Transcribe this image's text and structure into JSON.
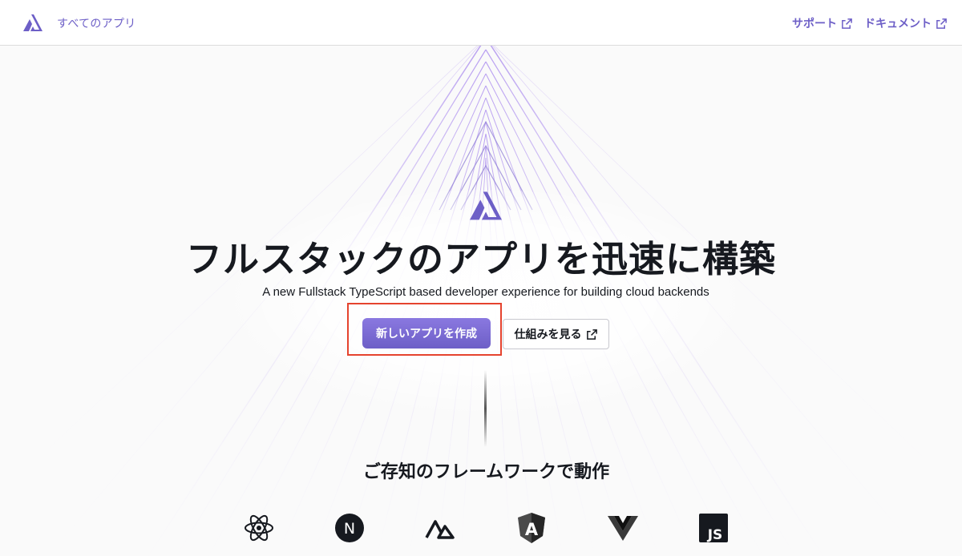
{
  "header": {
    "all_apps_label": "すべてのアプリ",
    "nav": [
      {
        "label": "サポート",
        "icon": "external-link-icon"
      },
      {
        "label": "ドキュメント",
        "icon": "external-link-icon"
      }
    ]
  },
  "hero": {
    "title": "フルスタックのアプリを迅速に構築",
    "subtitle": "A new Fullstack TypeScript based developer experience for building cloud backends",
    "primary_button": "新しいアプリを作成",
    "secondary_button": "仕組みを見る"
  },
  "frameworks": {
    "title": "ご存知のフレームワークで動作",
    "items": [
      {
        "icon": "react-icon"
      },
      {
        "icon": "nextjs-icon",
        "letter": "N"
      },
      {
        "icon": "nuxt-icon"
      },
      {
        "icon": "angular-icon",
        "letter": "A"
      },
      {
        "icon": "vue-icon"
      },
      {
        "icon": "javascript-icon",
        "letter": "JS"
      }
    ]
  },
  "colors": {
    "accent": "#6d5fc7",
    "highlight": "#e5432e",
    "text": "#16191f"
  }
}
